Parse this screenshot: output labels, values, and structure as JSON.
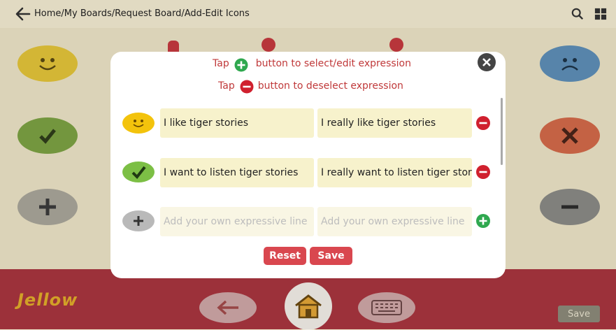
{
  "header": {
    "breadcrumb": "Home/My Boards/Request Board/Add-Edit Icons"
  },
  "dialog": {
    "hint_add_prefix": "Tap",
    "hint_add_suffix": "button to select/edit expression",
    "hint_remove_prefix": "Tap",
    "hint_remove_suffix": "button to deselect expression",
    "rows": [
      {
        "icon": "smiley-icon",
        "short": "I like tiger stories",
        "long": "I really like tiger stories",
        "action": "remove-icon"
      },
      {
        "icon": "check-icon",
        "short": "I want to listen tiger stories",
        "long": "I really want to listen tiger storie",
        "action": "remove-icon"
      },
      {
        "icon": "plus-icon",
        "short_placeholder": "Add your own expressive line",
        "long_placeholder": "Add your own expressive line",
        "action": "add-icon"
      }
    ],
    "reset_label": "Reset",
    "save_label": "Save"
  },
  "footer": {
    "logo_text": "Jellow",
    "save_label": "Save"
  },
  "colors": {
    "accent_red": "#d9474f",
    "footer": "#a8353f",
    "add_green": "#2fa84f",
    "remove_red": "#d0202e"
  }
}
